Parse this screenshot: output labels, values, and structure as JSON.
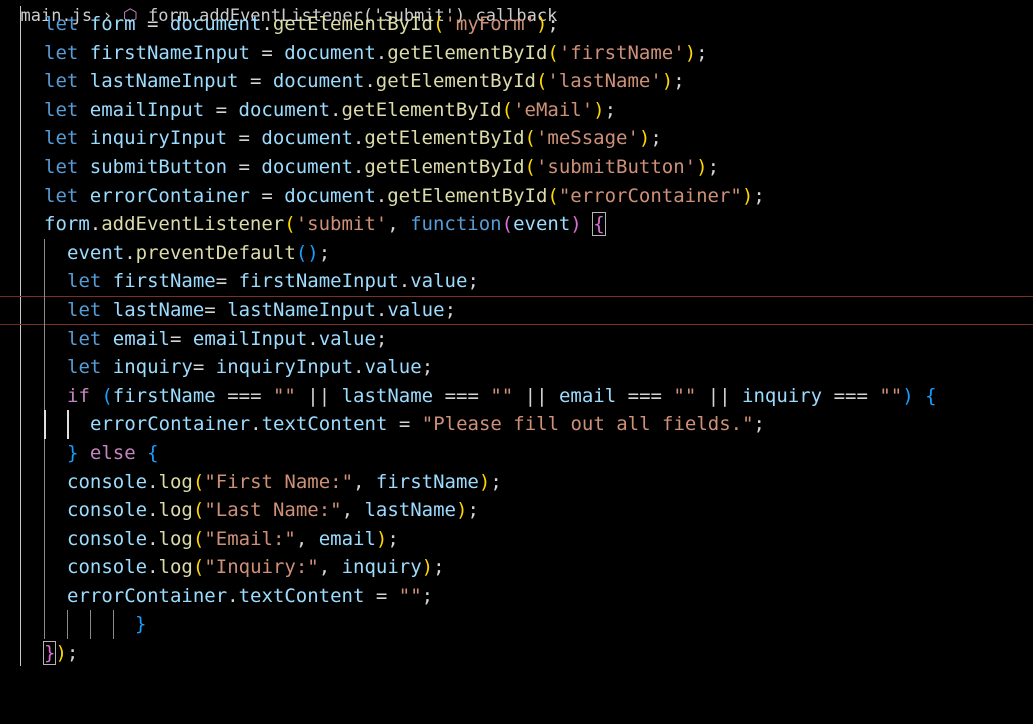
{
  "breadcrumb": {
    "file": "main.js",
    "symbol": "form.addEventListener('submit') callback"
  },
  "editor": {
    "lines": [
      [
        [
          "kw",
          "let"
        ],
        [
          "op",
          " "
        ],
        [
          "var",
          "form"
        ],
        [
          "op",
          " = "
        ],
        [
          "var",
          "document"
        ],
        [
          "op",
          "."
        ],
        [
          "fn",
          "getElementById"
        ],
        [
          "p1",
          "("
        ],
        [
          "str",
          "'myForm'"
        ],
        [
          "p1",
          ")"
        ],
        [
          "op",
          ";"
        ]
      ],
      [
        [
          "kw",
          "let"
        ],
        [
          "op",
          " "
        ],
        [
          "var",
          "firstNameInput"
        ],
        [
          "op",
          " = "
        ],
        [
          "var",
          "document"
        ],
        [
          "op",
          "."
        ],
        [
          "fn",
          "getElementById"
        ],
        [
          "p1",
          "("
        ],
        [
          "str",
          "'firstName'"
        ],
        [
          "p1",
          ")"
        ],
        [
          "op",
          ";"
        ]
      ],
      [
        [
          "kw",
          "let"
        ],
        [
          "op",
          " "
        ],
        [
          "var",
          "lastNameInput"
        ],
        [
          "op",
          " = "
        ],
        [
          "var",
          "document"
        ],
        [
          "op",
          "."
        ],
        [
          "fn",
          "getElementById"
        ],
        [
          "p1",
          "("
        ],
        [
          "str",
          "'lastName'"
        ],
        [
          "p1",
          ")"
        ],
        [
          "op",
          ";"
        ]
      ],
      [
        [
          "kw",
          "let"
        ],
        [
          "op",
          " "
        ],
        [
          "var",
          "emailInput"
        ],
        [
          "op",
          " = "
        ],
        [
          "var",
          "document"
        ],
        [
          "op",
          "."
        ],
        [
          "fn",
          "getElementById"
        ],
        [
          "p1",
          "("
        ],
        [
          "str",
          "'eMail'"
        ],
        [
          "p1",
          ")"
        ],
        [
          "op",
          ";"
        ]
      ],
      [
        [
          "kw",
          "let"
        ],
        [
          "op",
          " "
        ],
        [
          "var",
          "inquiryInput"
        ],
        [
          "op",
          " = "
        ],
        [
          "var",
          "document"
        ],
        [
          "op",
          "."
        ],
        [
          "fn",
          "getElementById"
        ],
        [
          "p1",
          "("
        ],
        [
          "str",
          "'meSsage'"
        ],
        [
          "p1",
          ")"
        ],
        [
          "op",
          ";"
        ]
      ],
      [
        [
          "kw",
          "let"
        ],
        [
          "op",
          " "
        ],
        [
          "var",
          "submitButton"
        ],
        [
          "op",
          " = "
        ],
        [
          "var",
          "document"
        ],
        [
          "op",
          "."
        ],
        [
          "fn",
          "getElementById"
        ],
        [
          "p1",
          "("
        ],
        [
          "str",
          "'submitButton'"
        ],
        [
          "p1",
          ")"
        ],
        [
          "op",
          ";"
        ]
      ],
      [
        [
          "kw",
          "let"
        ],
        [
          "op",
          " "
        ],
        [
          "var",
          "errorContainer"
        ],
        [
          "op",
          " = "
        ],
        [
          "var",
          "document"
        ],
        [
          "op",
          "."
        ],
        [
          "fn",
          "getElementById"
        ],
        [
          "p1",
          "("
        ],
        [
          "str",
          "\"errorContainer\""
        ],
        [
          "p1",
          ")"
        ],
        [
          "op",
          ";"
        ]
      ],
      [
        [
          "var",
          "form"
        ],
        [
          "op",
          "."
        ],
        [
          "fn",
          "addEventListener"
        ],
        [
          "p1",
          "("
        ],
        [
          "str",
          "'submit'"
        ],
        [
          "op",
          ", "
        ],
        [
          "kw",
          "function"
        ],
        [
          "p2",
          "("
        ],
        [
          "var",
          "event"
        ],
        [
          "p2",
          ")"
        ],
        [
          "op",
          " "
        ],
        [
          "p2",
          "{"
        ]
      ],
      [
        [
          "var",
          "event"
        ],
        [
          "op",
          "."
        ],
        [
          "fn",
          "preventDefault"
        ],
        [
          "p3",
          "()"
        ],
        [
          "op",
          ";"
        ]
      ],
      [
        [
          "kw",
          "let"
        ],
        [
          "op",
          " "
        ],
        [
          "var",
          "firstName"
        ],
        [
          "op",
          "= "
        ],
        [
          "var",
          "firstNameInput"
        ],
        [
          "op",
          "."
        ],
        [
          "var",
          "value"
        ],
        [
          "op",
          ";"
        ]
      ],
      [
        [
          "kw",
          "let"
        ],
        [
          "op",
          " "
        ],
        [
          "var",
          "lastName"
        ],
        [
          "op",
          "= "
        ],
        [
          "var",
          "lastNameInput"
        ],
        [
          "op",
          "."
        ],
        [
          "var",
          "value"
        ],
        [
          "op",
          ";"
        ]
      ],
      [
        [
          "kw",
          "let"
        ],
        [
          "op",
          " "
        ],
        [
          "var",
          "email"
        ],
        [
          "op",
          "= "
        ],
        [
          "var",
          "emailInput"
        ],
        [
          "op",
          "."
        ],
        [
          "var",
          "value"
        ],
        [
          "op",
          ";"
        ]
      ],
      [
        [
          "kw",
          "let"
        ],
        [
          "op",
          " "
        ],
        [
          "var",
          "inquiry"
        ],
        [
          "op",
          "= "
        ],
        [
          "var",
          "inquiryInput"
        ],
        [
          "op",
          "."
        ],
        [
          "var",
          "value"
        ],
        [
          "op",
          ";"
        ]
      ],
      [
        [
          "kw2",
          "if"
        ],
        [
          "op",
          " "
        ],
        [
          "p3",
          "("
        ],
        [
          "var",
          "firstName"
        ],
        [
          "op",
          " === "
        ],
        [
          "str",
          "\"\""
        ],
        [
          "op",
          " || "
        ],
        [
          "var",
          "lastName"
        ],
        [
          "op",
          " === "
        ],
        [
          "str",
          "\"\""
        ],
        [
          "op",
          " || "
        ],
        [
          "var",
          "email"
        ],
        [
          "op",
          " === "
        ],
        [
          "str",
          "\"\""
        ],
        [
          "op",
          " || "
        ],
        [
          "var",
          "inquiry"
        ],
        [
          "op",
          " === "
        ],
        [
          "str",
          "\"\""
        ],
        [
          "p3",
          ")"
        ],
        [
          "op",
          " "
        ],
        [
          "p3",
          "{"
        ]
      ],
      [
        [
          "var",
          "errorContainer"
        ],
        [
          "op",
          "."
        ],
        [
          "var",
          "textContent"
        ],
        [
          "op",
          " = "
        ],
        [
          "str",
          "\"Please fill out all fields.\""
        ],
        [
          "op",
          ";"
        ]
      ],
      [
        [
          "p3",
          "}"
        ],
        [
          "op",
          " "
        ],
        [
          "kw2",
          "else"
        ],
        [
          "op",
          " "
        ],
        [
          "p3",
          "{"
        ]
      ],
      [
        [
          "var",
          "console"
        ],
        [
          "op",
          "."
        ],
        [
          "fn",
          "log"
        ],
        [
          "p1",
          "("
        ],
        [
          "str",
          "\"First Name:\""
        ],
        [
          "op",
          ", "
        ],
        [
          "var",
          "firstName"
        ],
        [
          "p1",
          ")"
        ],
        [
          "op",
          ";"
        ]
      ],
      [
        [
          "var",
          "console"
        ],
        [
          "op",
          "."
        ],
        [
          "fn",
          "log"
        ],
        [
          "p1",
          "("
        ],
        [
          "str",
          "\"Last Name:\""
        ],
        [
          "op",
          ", "
        ],
        [
          "var",
          "lastName"
        ],
        [
          "p1",
          ")"
        ],
        [
          "op",
          ";"
        ]
      ],
      [
        [
          "var",
          "console"
        ],
        [
          "op",
          "."
        ],
        [
          "fn",
          "log"
        ],
        [
          "p1",
          "("
        ],
        [
          "str",
          "\"Email:\""
        ],
        [
          "op",
          ", "
        ],
        [
          "var",
          "email"
        ],
        [
          "p1",
          ")"
        ],
        [
          "op",
          ";"
        ]
      ],
      [
        [
          "var",
          "console"
        ],
        [
          "op",
          "."
        ],
        [
          "fn",
          "log"
        ],
        [
          "p1",
          "("
        ],
        [
          "str",
          "\"Inquiry:\""
        ],
        [
          "op",
          ", "
        ],
        [
          "var",
          "inquiry"
        ],
        [
          "p1",
          ")"
        ],
        [
          "op",
          ";"
        ]
      ],
      [
        [
          "var",
          "errorContainer"
        ],
        [
          "op",
          "."
        ],
        [
          "var",
          "textContent"
        ],
        [
          "op",
          " = "
        ],
        [
          "str",
          "\"\""
        ],
        [
          "op",
          ";"
        ]
      ],
      [
        [
          "p3",
          "}"
        ]
      ],
      [
        [
          "p2",
          "}"
        ],
        [
          "p1",
          ")"
        ],
        [
          "op",
          ";"
        ]
      ]
    ],
    "current_line": 11,
    "colors": {
      "background": "#000000",
      "keyword": "#569cd6",
      "control": "#c586c0",
      "variable": "#9cdcfe",
      "function": "#dcdcaa",
      "string": "#ce9178",
      "bracket_1": "#ffd700",
      "bracket_2": "#da70d6",
      "bracket_3": "#179fff"
    }
  }
}
